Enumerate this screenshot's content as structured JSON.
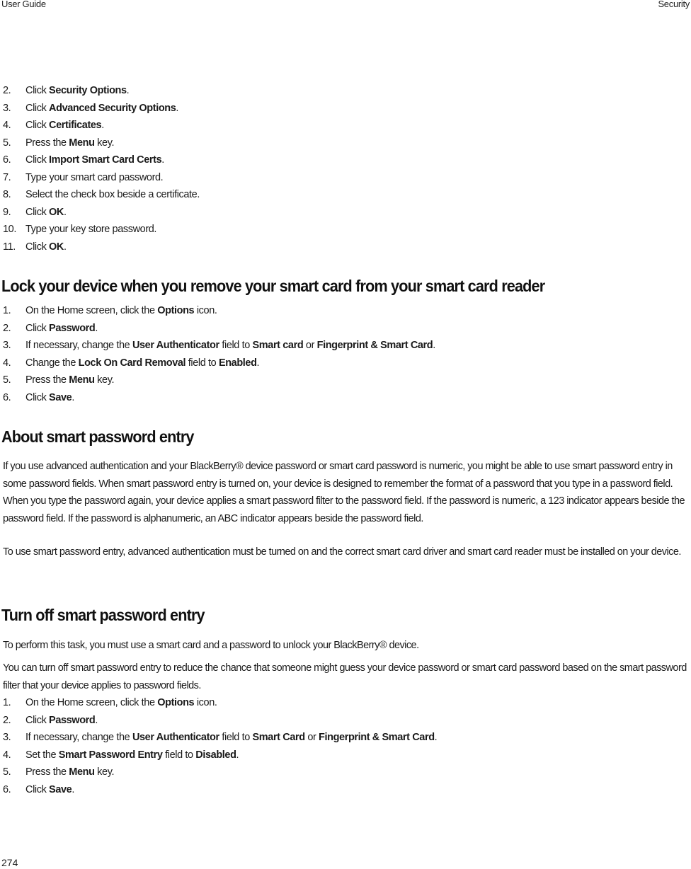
{
  "header": {
    "left": "User Guide",
    "right": "Security"
  },
  "footer": {
    "page_number": "274"
  },
  "list1": [
    {
      "num": "2.",
      "pre": "Click ",
      "bold": "Security Options",
      "post": "."
    },
    {
      "num": "3.",
      "pre": "Click ",
      "bold": "Advanced Security Options",
      "post": "."
    },
    {
      "num": "4.",
      "pre": "Click ",
      "bold": "Certificates",
      "post": "."
    },
    {
      "num": "5.",
      "pre": "Press the ",
      "bold": "Menu",
      "post": " key."
    },
    {
      "num": "6.",
      "pre": "Click ",
      "bold": "Import Smart Card Certs",
      "post": "."
    },
    {
      "num": "7.",
      "pre": "Type your smart card password.",
      "bold": "",
      "post": ""
    },
    {
      "num": "8.",
      "pre": "Select the check box beside a certificate.",
      "bold": "",
      "post": ""
    },
    {
      "num": "9.",
      "pre": "Click ",
      "bold": "OK",
      "post": "."
    },
    {
      "num": "10.",
      "pre": "Type your key store password.",
      "bold": "",
      "post": ""
    },
    {
      "num": "11.",
      "pre": "Click ",
      "bold": "OK",
      "post": "."
    }
  ],
  "section_lock": {
    "title": "Lock your device when you remove your smart card from your smart card reader",
    "steps": [
      {
        "num": "1.",
        "parts": [
          "On the Home screen, click the ",
          "Options",
          " icon."
        ]
      },
      {
        "num": "2.",
        "parts": [
          "Click ",
          "Password",
          "."
        ]
      },
      {
        "num": "3.",
        "parts": [
          "If necessary, change the ",
          "User Authenticator",
          " field to ",
          "Smart card",
          " or ",
          "Fingerprint & Smart Card",
          "."
        ]
      },
      {
        "num": "4.",
        "parts": [
          "Change the ",
          "Lock On Card Removal",
          " field to ",
          "Enabled",
          "."
        ]
      },
      {
        "num": "5.",
        "parts": [
          "Press the ",
          "Menu",
          " key."
        ]
      },
      {
        "num": "6.",
        "parts": [
          "Click ",
          "Save",
          "."
        ]
      }
    ]
  },
  "section_about": {
    "title": "About smart password entry",
    "para1": "If you use advanced authentication and your BlackBerry® device password or smart card password is numeric, you might be able to use smart password entry in some password fields. When smart password entry is turned on, your device is designed to remember the format of a password that you type in a password field. When you type the password again, your device applies a smart password filter to the password field. If the password is numeric, a 123 indicator appears beside the password field. If the password is alphanumeric, an ABC indicator appears beside the password field.",
    "para2": "To use smart password entry, advanced authentication must be turned on and the correct smart card driver and smart card reader must be installed on your device."
  },
  "section_turnoff": {
    "title": "Turn off smart password entry",
    "para1": "To perform this task, you must use a smart card and a password to unlock your BlackBerry® device.",
    "para2": "You can turn off smart password entry to reduce the chance that someone might guess your device password or smart card password based on the smart password filter that your device applies to password fields.",
    "steps": [
      {
        "num": "1.",
        "parts": [
          "On the Home screen, click the ",
          "Options",
          " icon."
        ]
      },
      {
        "num": "2.",
        "parts": [
          "Click ",
          "Password",
          "."
        ]
      },
      {
        "num": "3.",
        "parts": [
          "If necessary, change the ",
          "User Authenticator",
          " field to ",
          "Smart Card",
          " or ",
          "Fingerprint & Smart Card",
          "."
        ]
      },
      {
        "num": "4.",
        "parts": [
          "Set the ",
          "Smart Password Entry",
          " field to ",
          "Disabled",
          "."
        ]
      },
      {
        "num": "5.",
        "parts": [
          "Press the ",
          "Menu",
          " key."
        ]
      },
      {
        "num": "6.",
        "parts": [
          "Click ",
          "Save",
          "."
        ]
      }
    ]
  }
}
